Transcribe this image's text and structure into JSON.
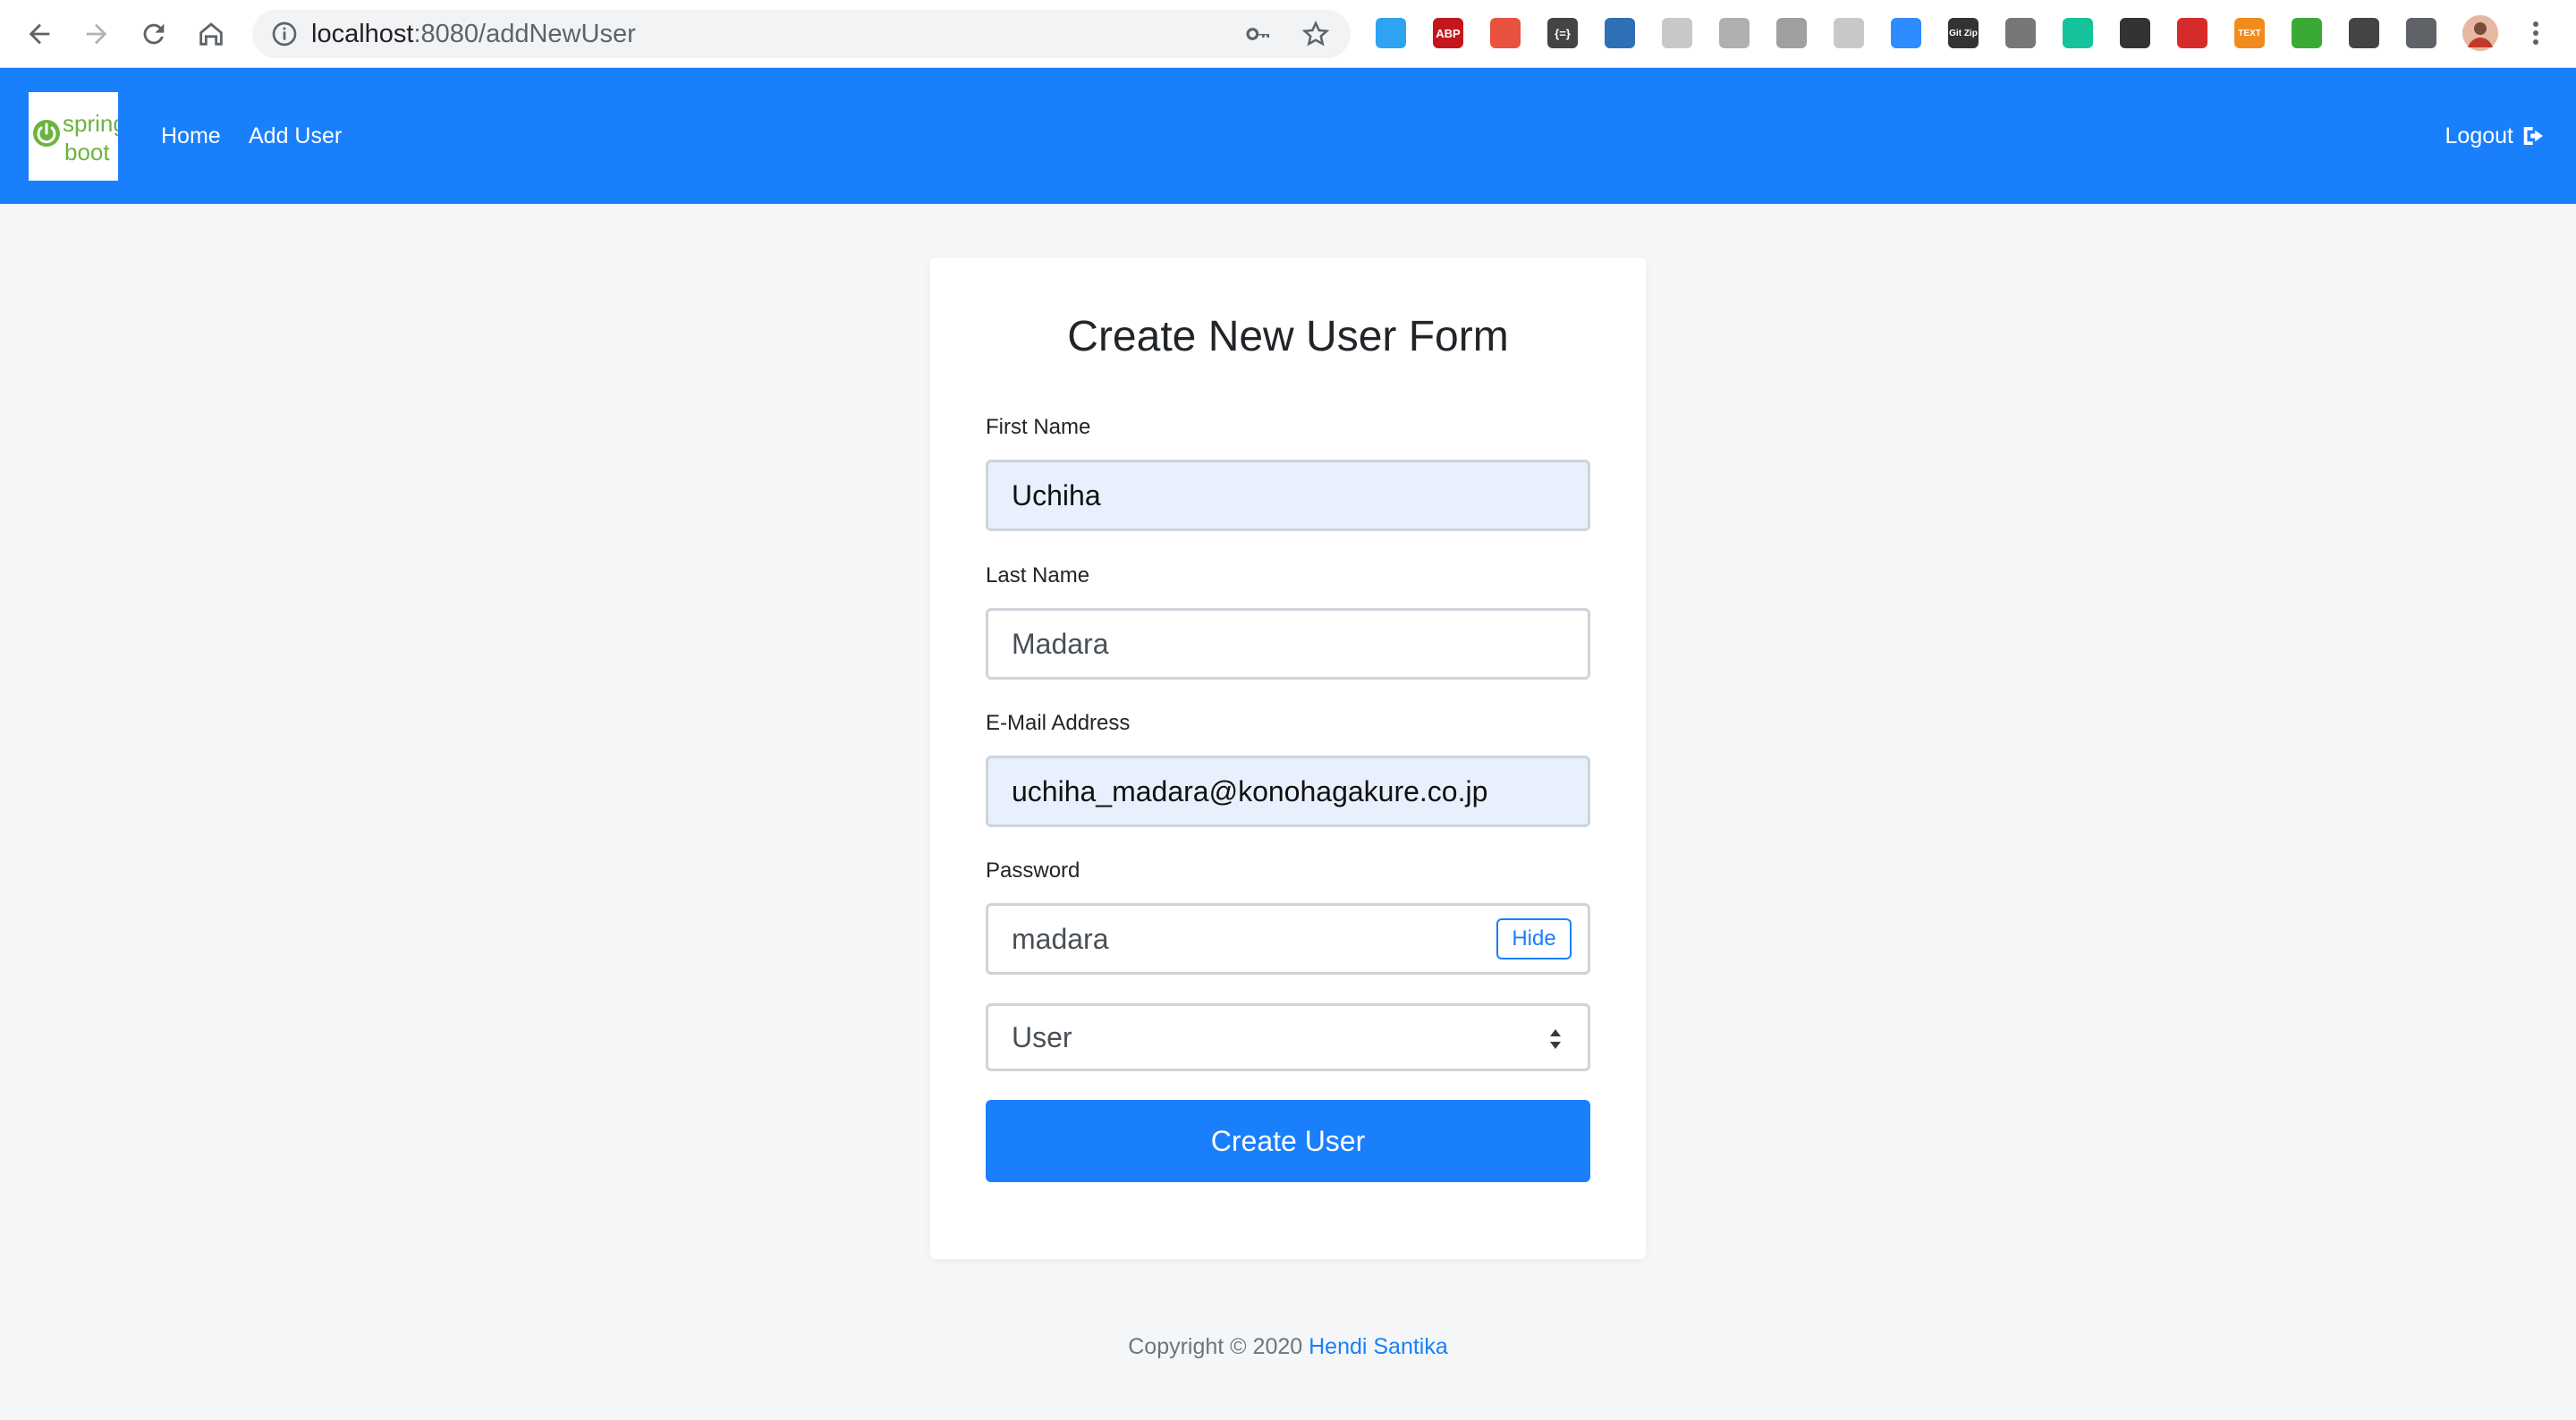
{
  "browser": {
    "url_host": "localhost",
    "url_rest": ":8080/addNewUser",
    "extensions": [
      {
        "icon": "tab-manager-icon",
        "color": "#2ea3f2"
      },
      {
        "icon": "adblock-plus-icon",
        "label": "ABP",
        "color": "#c4161c"
      },
      {
        "icon": "sitemap-icon",
        "color": "#e8523f"
      },
      {
        "icon": "json-formatter-icon",
        "label": "{=}",
        "color": "#444444"
      },
      {
        "icon": "s-logo-icon",
        "color": "#2f6fb5"
      },
      {
        "icon": "bookmark-icon",
        "color": "#c8c8c8"
      },
      {
        "icon": "chat-icon",
        "color": "#b0b0b0"
      },
      {
        "icon": "vue-devtools-icon",
        "color": "#a0a0a0"
      },
      {
        "icon": "react-devtools-icon",
        "color": "#c8c8c8"
      },
      {
        "icon": "zoom-icon",
        "color": "#2d8cff"
      },
      {
        "icon": "gitzip-icon",
        "label": "Git Zip",
        "color": "#333333"
      },
      {
        "icon": "screenshot-icon",
        "color": "#777777"
      },
      {
        "icon": "grammarly-icon",
        "color": "#15c39a"
      },
      {
        "icon": "refresh-circle-icon",
        "color": "#333333"
      },
      {
        "icon": "red-circle-icon",
        "color": "#d62b2b"
      },
      {
        "icon": "text-icon",
        "label": "TEXT",
        "color": "#f08c1e"
      },
      {
        "icon": "puzzle-gear-icon",
        "color": "#3aaa35"
      },
      {
        "icon": "shield-u-icon",
        "color": "#444444"
      },
      {
        "icon": "extensions-icon",
        "color": "#5f6368"
      }
    ]
  },
  "navbar": {
    "brand_color": "#1a7ffb",
    "logo_line1": "spring",
    "logo_line2": "boot",
    "links": [
      "Home",
      "Add User"
    ],
    "logout_label": "Logout"
  },
  "form": {
    "title": "Create New User Form",
    "first_name": {
      "label": "First Name",
      "value": "Uchiha"
    },
    "last_name": {
      "label": "Last Name",
      "value": "Madara"
    },
    "email": {
      "label": "E-Mail Address",
      "value": "uchiha_madara@konohagakure.co.jp"
    },
    "password": {
      "label": "Password",
      "value": "madara",
      "toggle_label": "Hide"
    },
    "role": {
      "selected": "User"
    },
    "submit_label": "Create User"
  },
  "footer": {
    "prefix": "Copyright © 2020",
    "author": "Hendi Santika"
  }
}
